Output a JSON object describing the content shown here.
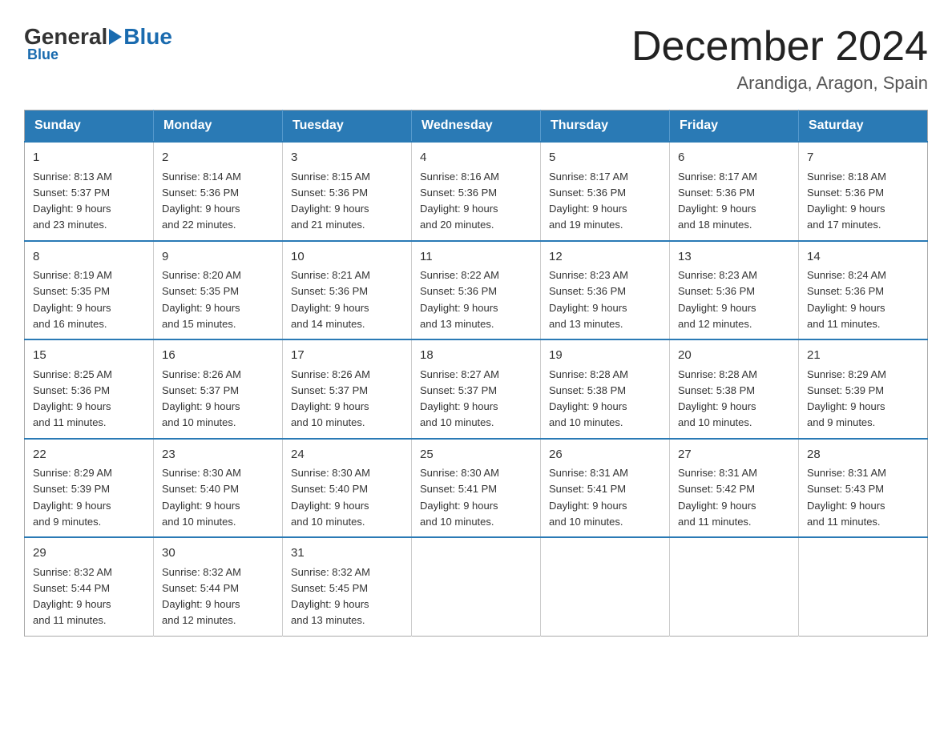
{
  "logo": {
    "general": "General",
    "blue": "Blue"
  },
  "header": {
    "title": "December 2024",
    "subtitle": "Arandiga, Aragon, Spain"
  },
  "days": [
    "Sunday",
    "Monday",
    "Tuesday",
    "Wednesday",
    "Thursday",
    "Friday",
    "Saturday"
  ],
  "weeks": [
    [
      {
        "day": "1",
        "sunrise": "8:13 AM",
        "sunset": "5:37 PM",
        "daylight": "9 hours and 23 minutes."
      },
      {
        "day": "2",
        "sunrise": "8:14 AM",
        "sunset": "5:36 PM",
        "daylight": "9 hours and 22 minutes."
      },
      {
        "day": "3",
        "sunrise": "8:15 AM",
        "sunset": "5:36 PM",
        "daylight": "9 hours and 21 minutes."
      },
      {
        "day": "4",
        "sunrise": "8:16 AM",
        "sunset": "5:36 PM",
        "daylight": "9 hours and 20 minutes."
      },
      {
        "day": "5",
        "sunrise": "8:17 AM",
        "sunset": "5:36 PM",
        "daylight": "9 hours and 19 minutes."
      },
      {
        "day": "6",
        "sunrise": "8:17 AM",
        "sunset": "5:36 PM",
        "daylight": "9 hours and 18 minutes."
      },
      {
        "day": "7",
        "sunrise": "8:18 AM",
        "sunset": "5:36 PM",
        "daylight": "9 hours and 17 minutes."
      }
    ],
    [
      {
        "day": "8",
        "sunrise": "8:19 AM",
        "sunset": "5:35 PM",
        "daylight": "9 hours and 16 minutes."
      },
      {
        "day": "9",
        "sunrise": "8:20 AM",
        "sunset": "5:35 PM",
        "daylight": "9 hours and 15 minutes."
      },
      {
        "day": "10",
        "sunrise": "8:21 AM",
        "sunset": "5:36 PM",
        "daylight": "9 hours and 14 minutes."
      },
      {
        "day": "11",
        "sunrise": "8:22 AM",
        "sunset": "5:36 PM",
        "daylight": "9 hours and 13 minutes."
      },
      {
        "day": "12",
        "sunrise": "8:23 AM",
        "sunset": "5:36 PM",
        "daylight": "9 hours and 13 minutes."
      },
      {
        "day": "13",
        "sunrise": "8:23 AM",
        "sunset": "5:36 PM",
        "daylight": "9 hours and 12 minutes."
      },
      {
        "day": "14",
        "sunrise": "8:24 AM",
        "sunset": "5:36 PM",
        "daylight": "9 hours and 11 minutes."
      }
    ],
    [
      {
        "day": "15",
        "sunrise": "8:25 AM",
        "sunset": "5:36 PM",
        "daylight": "9 hours and 11 minutes."
      },
      {
        "day": "16",
        "sunrise": "8:26 AM",
        "sunset": "5:37 PM",
        "daylight": "9 hours and 10 minutes."
      },
      {
        "day": "17",
        "sunrise": "8:26 AM",
        "sunset": "5:37 PM",
        "daylight": "9 hours and 10 minutes."
      },
      {
        "day": "18",
        "sunrise": "8:27 AM",
        "sunset": "5:37 PM",
        "daylight": "9 hours and 10 minutes."
      },
      {
        "day": "19",
        "sunrise": "8:28 AM",
        "sunset": "5:38 PM",
        "daylight": "9 hours and 10 minutes."
      },
      {
        "day": "20",
        "sunrise": "8:28 AM",
        "sunset": "5:38 PM",
        "daylight": "9 hours and 10 minutes."
      },
      {
        "day": "21",
        "sunrise": "8:29 AM",
        "sunset": "5:39 PM",
        "daylight": "9 hours and 9 minutes."
      }
    ],
    [
      {
        "day": "22",
        "sunrise": "8:29 AM",
        "sunset": "5:39 PM",
        "daylight": "9 hours and 9 minutes."
      },
      {
        "day": "23",
        "sunrise": "8:30 AM",
        "sunset": "5:40 PM",
        "daylight": "9 hours and 10 minutes."
      },
      {
        "day": "24",
        "sunrise": "8:30 AM",
        "sunset": "5:40 PM",
        "daylight": "9 hours and 10 minutes."
      },
      {
        "day": "25",
        "sunrise": "8:30 AM",
        "sunset": "5:41 PM",
        "daylight": "9 hours and 10 minutes."
      },
      {
        "day": "26",
        "sunrise": "8:31 AM",
        "sunset": "5:41 PM",
        "daylight": "9 hours and 10 minutes."
      },
      {
        "day": "27",
        "sunrise": "8:31 AM",
        "sunset": "5:42 PM",
        "daylight": "9 hours and 11 minutes."
      },
      {
        "day": "28",
        "sunrise": "8:31 AM",
        "sunset": "5:43 PM",
        "daylight": "9 hours and 11 minutes."
      }
    ],
    [
      {
        "day": "29",
        "sunrise": "8:32 AM",
        "sunset": "5:44 PM",
        "daylight": "9 hours and 11 minutes."
      },
      {
        "day": "30",
        "sunrise": "8:32 AM",
        "sunset": "5:44 PM",
        "daylight": "9 hours and 12 minutes."
      },
      {
        "day": "31",
        "sunrise": "8:32 AM",
        "sunset": "5:45 PM",
        "daylight": "9 hours and 13 minutes."
      },
      null,
      null,
      null,
      null
    ]
  ],
  "labels": {
    "sunrise": "Sunrise:",
    "sunset": "Sunset:",
    "daylight": "Daylight:"
  }
}
